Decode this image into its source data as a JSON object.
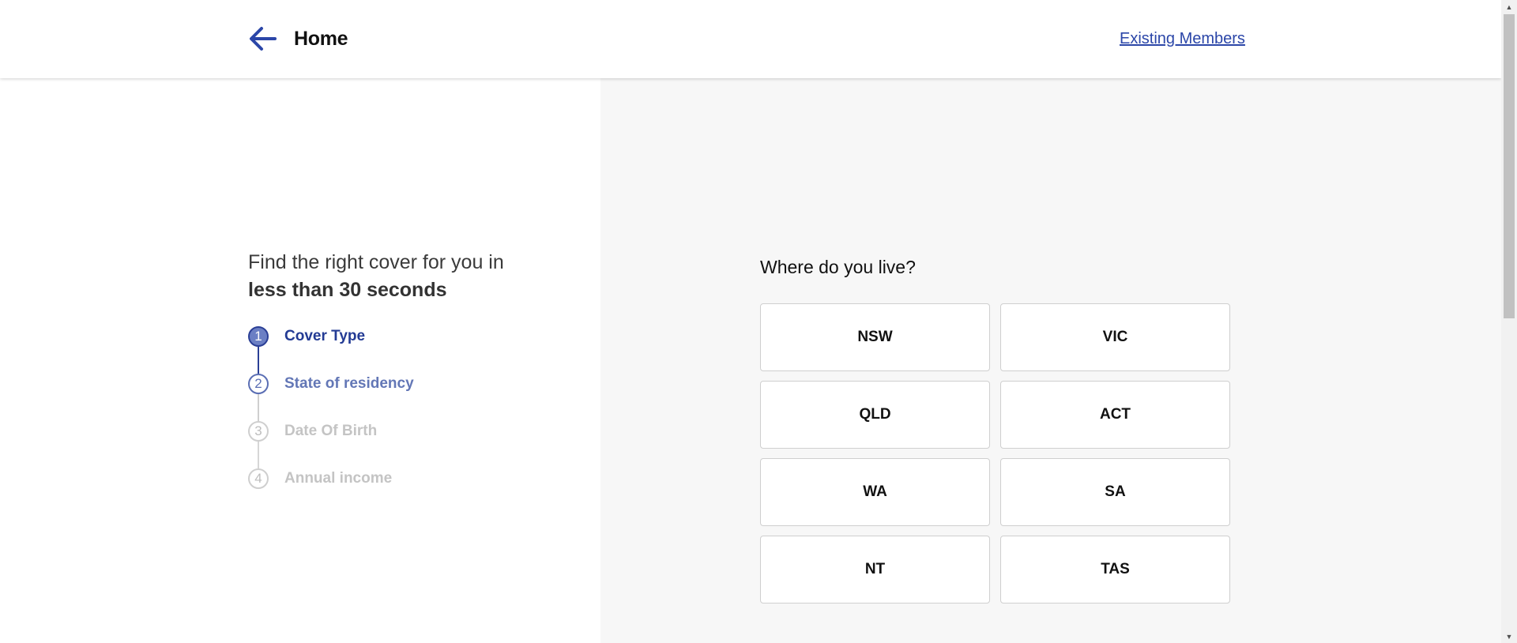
{
  "header": {
    "back_label": "Home",
    "existing_members": "Existing Members"
  },
  "intro": {
    "line1": "Find the right cover for you in",
    "line2": "less than 30 seconds"
  },
  "steps": [
    {
      "number": "1",
      "label": "Cover Type",
      "state": "active"
    },
    {
      "number": "2",
      "label": "State of residency",
      "state": "next"
    },
    {
      "number": "3",
      "label": "Date Of Birth",
      "state": "future"
    },
    {
      "number": "4",
      "label": "Annual income",
      "state": "future"
    }
  ],
  "question": "Where do you live?",
  "options": [
    "NSW",
    "VIC",
    "QLD",
    "ACT",
    "WA",
    "SA",
    "NT",
    "TAS"
  ],
  "colors": {
    "brand": "#2b46a8",
    "panel_bg": "#f7f7f7"
  },
  "icons": {
    "back": "arrow-left-icon"
  }
}
